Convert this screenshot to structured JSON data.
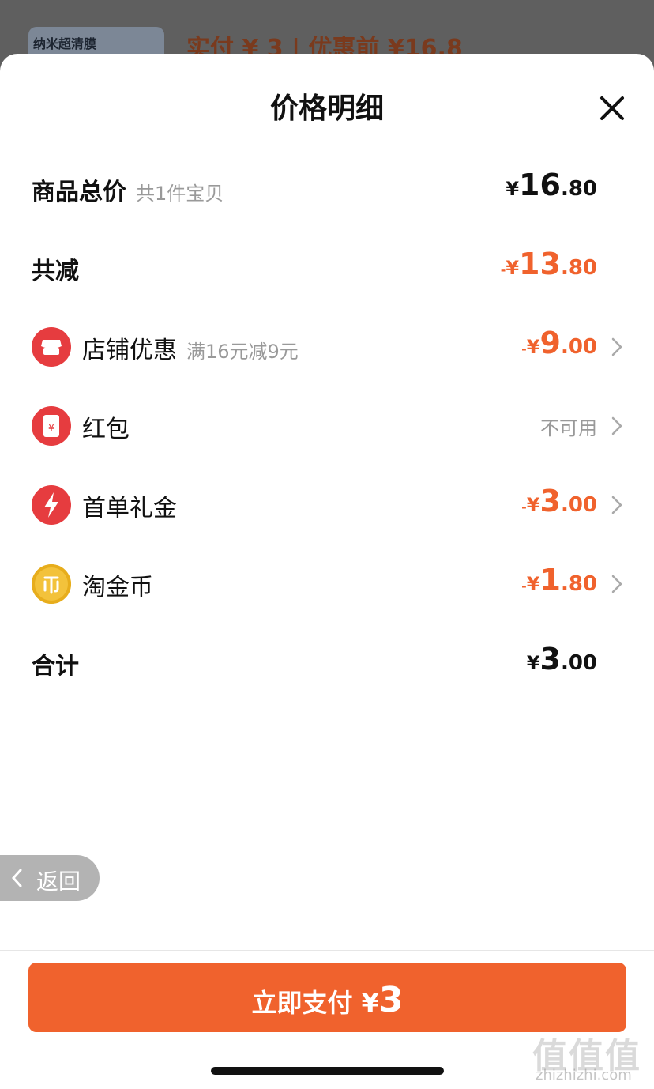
{
  "background": {
    "thumb_label": "纳米超清膜",
    "price_text": "实付 ¥ 3 | 优惠前 ¥16.8"
  },
  "sheet": {
    "title": "价格明细",
    "close_icon": "close-icon"
  },
  "rows": [
    {
      "label": "商品总价",
      "sub": "共1件宝贝",
      "amount": {
        "prefix": "",
        "sym": "¥",
        "int": "16",
        "dec": ".80"
      },
      "color": "#111111"
    },
    {
      "label": "共减",
      "sub": "",
      "amount": {
        "prefix": "-",
        "sym": "¥",
        "int": "13",
        "dec": ".80"
      },
      "color": "#f0622d"
    },
    {
      "label": "店铺优惠",
      "sub": "满16元减9元",
      "icon": "store-icon",
      "amount": {
        "prefix": "-",
        "sym": "¥",
        "int": "9",
        "dec": ".00"
      },
      "color": "#f0622d"
    },
    {
      "label": "红包",
      "sub": "",
      "icon": "red-packet-icon",
      "amount_text": "不可用",
      "color": "#999999"
    },
    {
      "label": "首单礼金",
      "sub": "",
      "icon": "lightning-icon",
      "amount": {
        "prefix": "-",
        "sym": "¥",
        "int": "3",
        "dec": ".00"
      },
      "color": "#f0622d"
    },
    {
      "label": "淘金币",
      "sub": "",
      "icon": "coin-icon",
      "amount": {
        "prefix": "-",
        "sym": "¥",
        "int": "1",
        "dec": ".80"
      },
      "color": "#f0622d"
    },
    {
      "label": "合计",
      "sub": "",
      "amount": {
        "prefix": "",
        "sym": "¥",
        "int": "3",
        "dec": ".00"
      },
      "color": "#111111"
    }
  ],
  "back": {
    "label": "返回"
  },
  "pay_button": {
    "label": "立即支付",
    "sym": "¥",
    "amount": "3",
    "color": "#f0622d"
  },
  "watermark": {
    "logo": "值值值",
    "site": "zhizhizhi.com"
  }
}
